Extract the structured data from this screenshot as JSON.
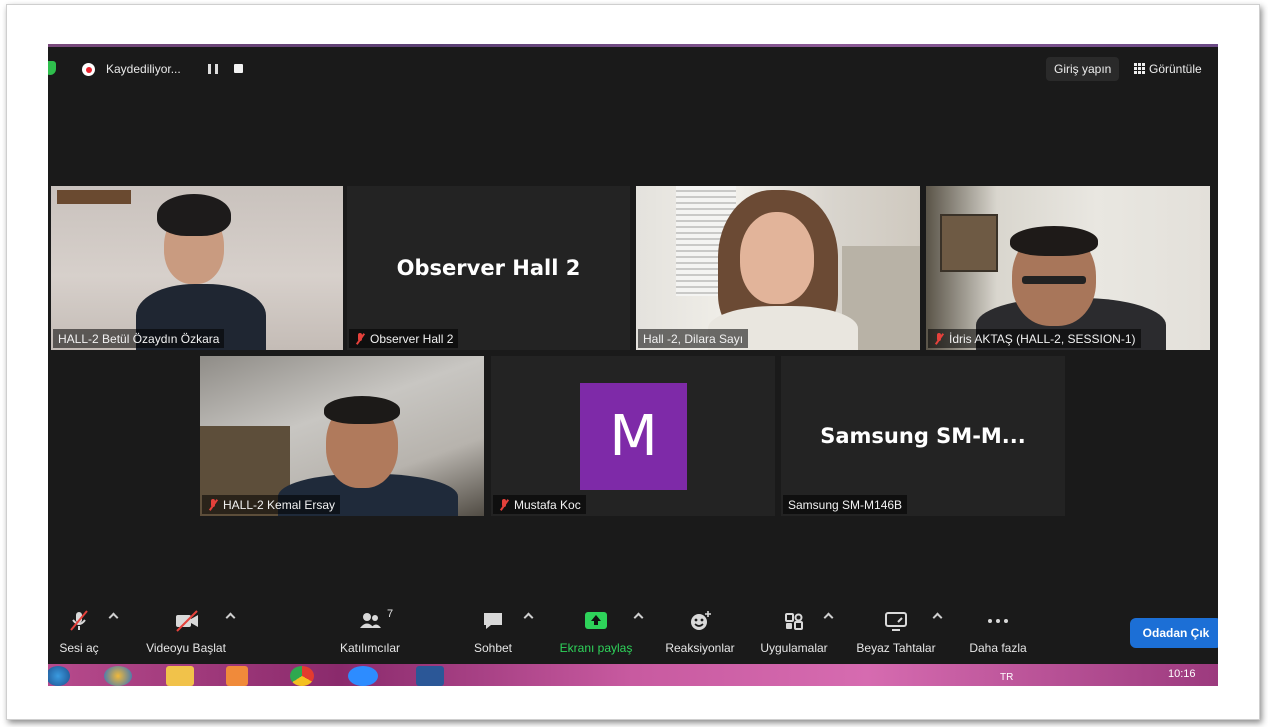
{
  "recording": {
    "label": "Kaydediliyor..."
  },
  "header": {
    "signin": "Giriş yapın",
    "view": "Görüntüle"
  },
  "tiles": [
    {
      "name": "HALL-2 Betül Özaydın Özkara",
      "muted": false,
      "active": true
    },
    {
      "name": "Observer Hall 2",
      "display_name": "Observer Hall 2",
      "muted": true
    },
    {
      "name": "Hall -2, Dilara Sayı",
      "muted": false
    },
    {
      "name": "İdris AKTAŞ (HALL-2, SESSION-1)",
      "muted": true
    },
    {
      "name": "HALL-2 Kemal Ersay",
      "muted": true
    },
    {
      "name": "Mustafa Koc",
      "avatar_letter": "M",
      "muted": true
    },
    {
      "name": "Samsung SM-M146B",
      "display_name": "Samsung  SM-M...",
      "muted": false
    }
  ],
  "toolbar": {
    "audio": "Sesi aç",
    "video": "Videoyu Başlat",
    "participants": "Katılımcılar",
    "participants_count": "7",
    "chat": "Sohbet",
    "share": "Ekranı paylaş",
    "reactions": "Reaksiyonlar",
    "apps": "Uygulamalar",
    "whiteboards": "Beyaz Tahtalar",
    "more": "Daha fazla",
    "leave": "Odadan Çık"
  },
  "taskbar": {
    "lang": "TR",
    "time": "10:16"
  },
  "colors": {
    "accent": "#1c6fd6",
    "share_green": "#2ed35a",
    "active_border": "#e6f26a",
    "avatar": "#7e2aa8",
    "muted_red": "#e5413b"
  }
}
